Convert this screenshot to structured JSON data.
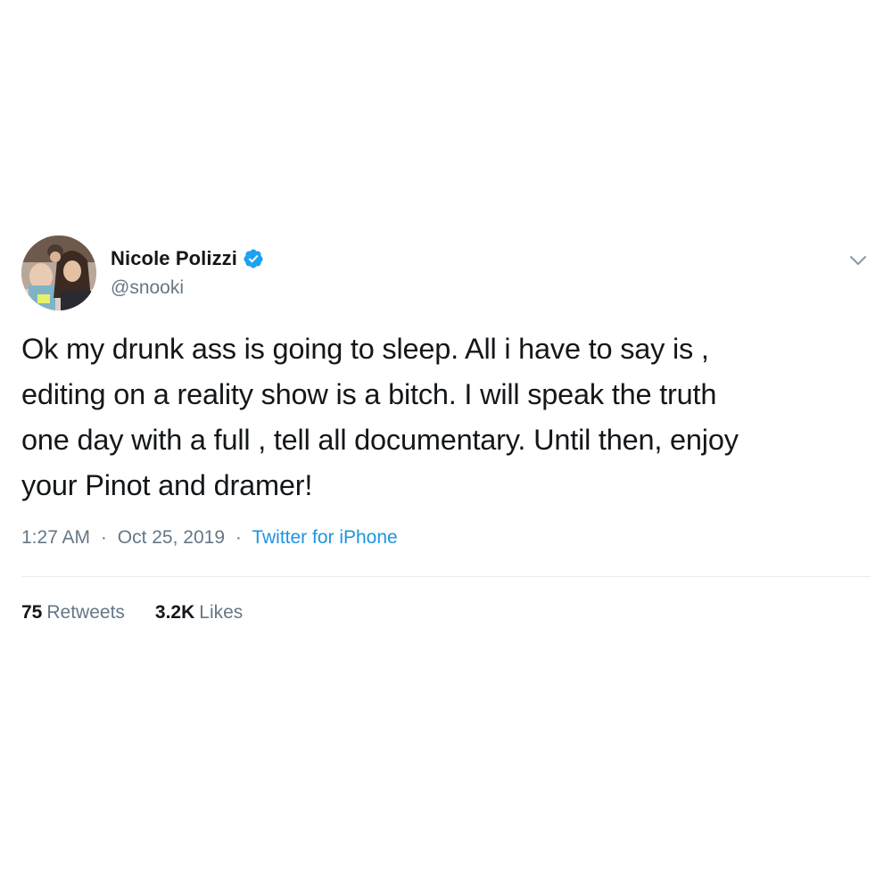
{
  "tweet": {
    "author": {
      "display_name": "Nicole Polizzi",
      "handle": "@snooki",
      "verified": true
    },
    "text_lines": [
      "Ok my drunk ass is going to sleep. All i have to say is ,",
      "editing on a reality show is a bitch. I will speak the truth",
      "one day with a full , tell all documentary. Until then, enjoy",
      "your Pinot and dramer!"
    ],
    "time": "1:27 AM",
    "date": "Oct 25, 2019",
    "separator": "·",
    "source": "Twitter for iPhone",
    "stats": {
      "retweets_count": "75",
      "retweets_label": "Retweets",
      "likes_count": "3.2K",
      "likes_label": "Likes"
    }
  },
  "colors": {
    "text": "#14171a",
    "muted": "#657786",
    "link": "#1b95e0",
    "verified": "#1da1f2",
    "divider": "#e6ecf0"
  },
  "icons": {
    "verified": "verified-badge-icon",
    "caret": "chevron-down-icon"
  }
}
